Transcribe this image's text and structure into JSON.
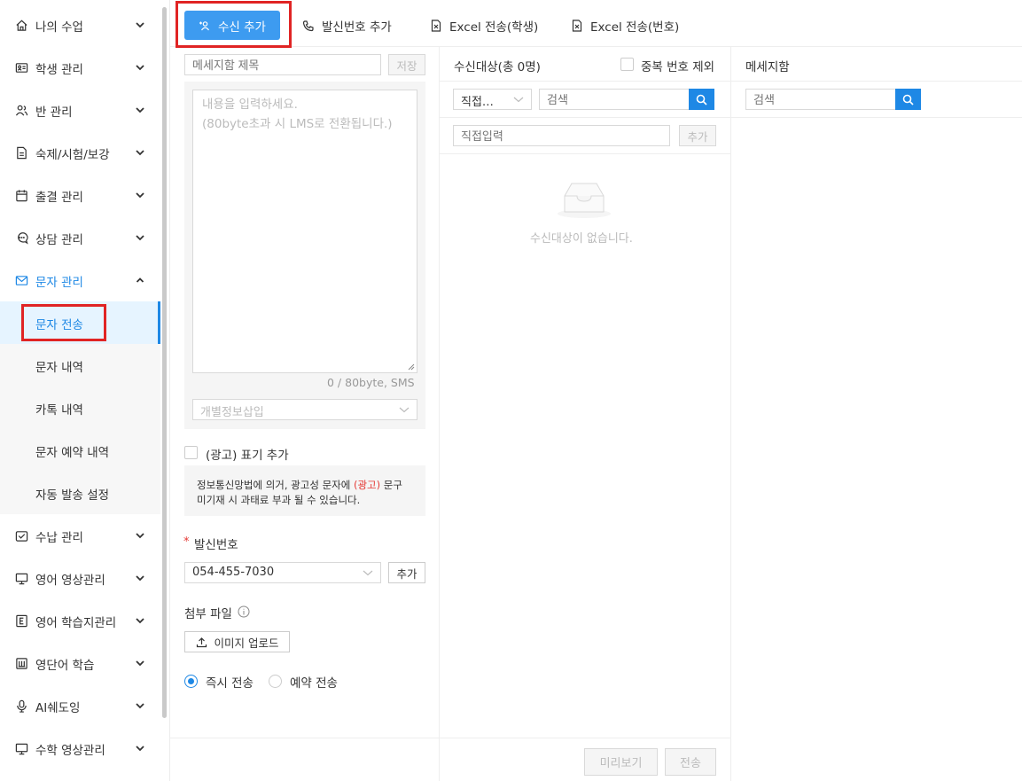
{
  "sidebar": {
    "items": [
      {
        "label": "나의 수업",
        "icon": "home-icon"
      },
      {
        "label": "학생 관리",
        "icon": "id-card-icon"
      },
      {
        "label": "반 관리",
        "icon": "users-icon"
      },
      {
        "label": "숙제/시험/보강",
        "icon": "document-icon"
      },
      {
        "label": "출결 관리",
        "icon": "calendar-icon"
      },
      {
        "label": "상담 관리",
        "icon": "chat-icon"
      },
      {
        "label": "문자 관리",
        "icon": "mail-icon"
      },
      {
        "label": "수납 관리",
        "icon": "payment-icon"
      },
      {
        "label": "영어 영상관리",
        "icon": "monitor-icon"
      },
      {
        "label": "영어 학습지관리",
        "icon": "letter-e-icon"
      },
      {
        "label": "영단어 학습",
        "icon": "book-icon"
      },
      {
        "label": "AI쉐도잉",
        "icon": "microphone-icon"
      },
      {
        "label": "수학 영상관리",
        "icon": "monitor-icon"
      }
    ],
    "sub_items": [
      {
        "label": "문자 전송"
      },
      {
        "label": "문자 내역"
      },
      {
        "label": "카톡 내역"
      },
      {
        "label": "문자 예약 내역"
      },
      {
        "label": "자동 발송 설정"
      }
    ]
  },
  "toolbar": {
    "add_recipient": "수신 추가",
    "add_sender": "발신번호 추가",
    "excel_student": "Excel 전송(학생)",
    "excel_number": "Excel 전송(번호)"
  },
  "compose": {
    "title_placeholder": "메세지함 제목",
    "save_label": "저장",
    "body_placeholder_line1": "내용을 입력하세요.",
    "body_placeholder_line2": "(80byte초과 시 LMS로 전환됩니다.)",
    "byte_count": "0 / 80byte, SMS",
    "personal_info_placeholder": "개별정보삽입",
    "ad_label": "(광고) 표기 추가",
    "ad_notice_pre": "정보통신망법에 의거, 광고성 문자에 ",
    "ad_notice_highlight": "(광고)",
    "ad_notice_post": " 문구",
    "ad_notice_line2": "미기재 시 과태료 부과 될 수 있습니다.",
    "sender_required_mark": "*",
    "sender_label": "발신번호",
    "sender_number": "054-455-7030",
    "sender_add": "추가",
    "attach_label": "첨부 파일",
    "upload_label": "이미지 업로드",
    "send_now": "즉시 전송",
    "send_scheduled": "예약 전송"
  },
  "recipients": {
    "header": "수신대상(총 0명)",
    "dedupe_label": "중복 번호 제외",
    "filter_value": "직접…",
    "search_placeholder": "검색",
    "direct_placeholder": "직접입력",
    "add_label": "추가",
    "empty_text": "수신대상이 없습니다."
  },
  "message_box": {
    "header": "메세지함",
    "search_placeholder": "검색"
  },
  "footer": {
    "preview_label": "미리보기",
    "send_label": "전송"
  },
  "colors": {
    "accent": "#1e88e5",
    "primary_button": "#3d9bf0",
    "highlight_red": "#e02424"
  }
}
